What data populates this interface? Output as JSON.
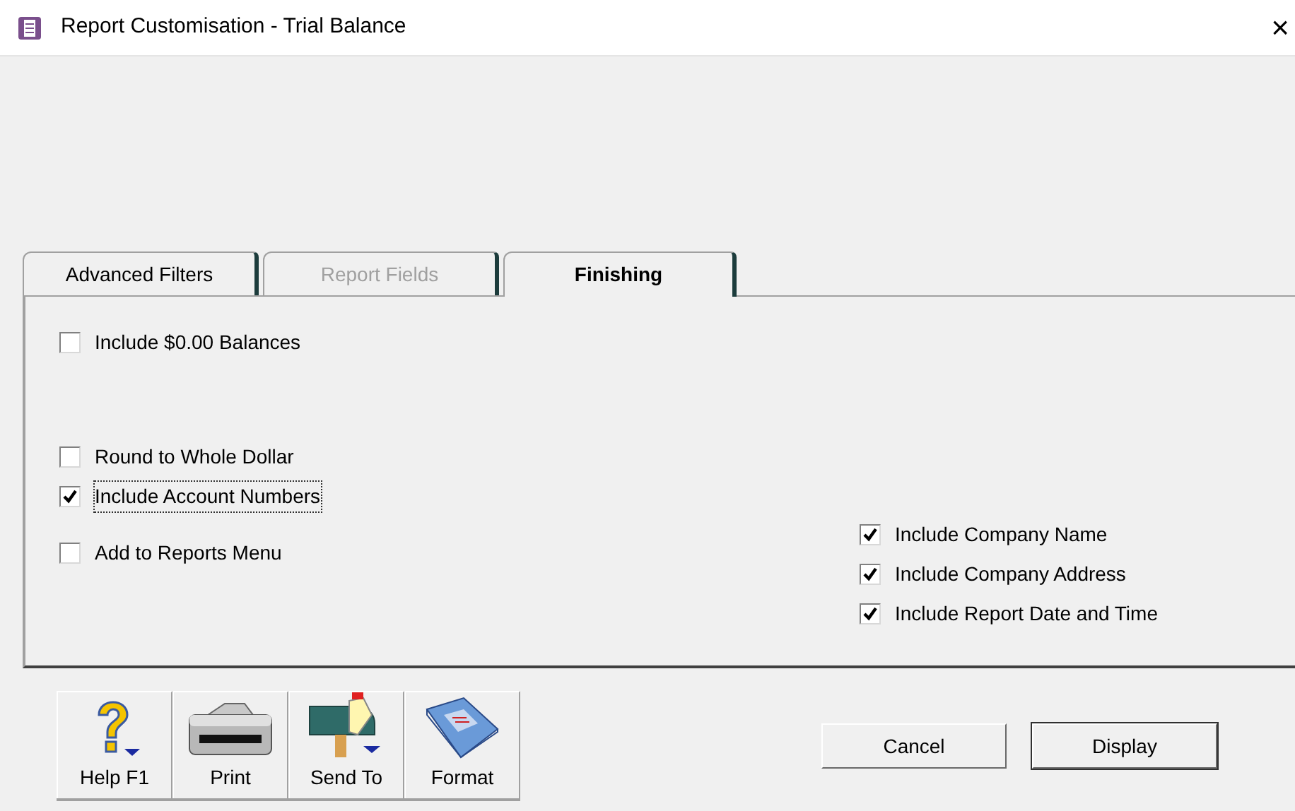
{
  "window": {
    "title": "Report Customisation - Trial Balance",
    "close": "×"
  },
  "tabs": [
    {
      "label": "Advanced Filters",
      "selected": false,
      "disabled": false
    },
    {
      "label": "Report Fields",
      "selected": false,
      "disabled": true
    },
    {
      "label": "Finishing",
      "selected": true,
      "disabled": false
    }
  ],
  "option_groups_left": [
    [
      {
        "label": "Include $0.00 Balances",
        "checked": false,
        "focused": false
      }
    ],
    [
      {
        "label": "Round to Whole Dollar",
        "checked": false,
        "focused": false
      },
      {
        "label": "Include Account Numbers",
        "checked": true,
        "focused": true
      }
    ],
    [
      {
        "label": "Add to Reports Menu",
        "checked": false,
        "focused": false
      }
    ]
  ],
  "options_right": [
    {
      "label": "Include Company Name",
      "checked": true,
      "focused": false
    },
    {
      "label": "Include Company Address",
      "checked": true,
      "focused": false
    },
    {
      "label": "Include Report Date and Time",
      "checked": true,
      "focused": false
    }
  ],
  "toolbar": [
    {
      "kind": "help",
      "label": "Help F1"
    },
    {
      "kind": "print",
      "label": "Print"
    },
    {
      "kind": "send",
      "label": "Send To"
    },
    {
      "kind": "format",
      "label": "Format"
    }
  ],
  "buttons": [
    {
      "label": "Cancel",
      "default": false
    },
    {
      "label": "Display",
      "default": true
    }
  ]
}
